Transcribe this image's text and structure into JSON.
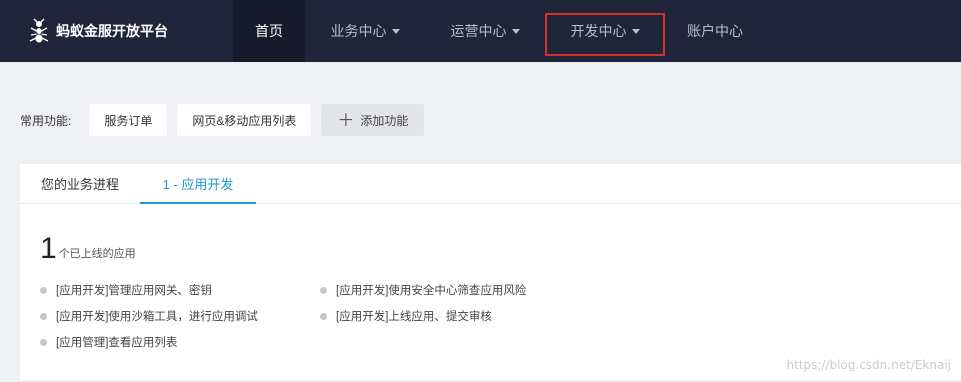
{
  "brand": {
    "name": "蚂蚁金服开放平台",
    "logo_icon": "ant-icon"
  },
  "nav": {
    "home": "首页",
    "business": "业务中心",
    "operations": "运营中心",
    "developer": "开发中心",
    "account": "账户中心"
  },
  "quick": {
    "label": "常用功能:",
    "items": [
      "服务订单",
      "网页&移动应用列表"
    ],
    "add_label": "添加功能"
  },
  "tabs": {
    "progress": "您的业务进程",
    "dev": "1 - 应用开发"
  },
  "summary": {
    "count": "1",
    "count_label": "个已上线的应用"
  },
  "tasks": [
    "[应用开发]管理应用网关、密钥",
    "[应用开发]使用安全中心筛查应用风险",
    "[应用开发]使用沙箱工具，进行应用调试",
    "[应用开发]上线应用、提交审核",
    "[应用管理]查看应用列表"
  ],
  "watermark": "https://blog.csdn.net/Eknaij",
  "colors": {
    "topbar": "#20253a",
    "active_tab": "#1e96d6",
    "highlight": "#d6302e",
    "page_bg": "#eef0f4"
  }
}
